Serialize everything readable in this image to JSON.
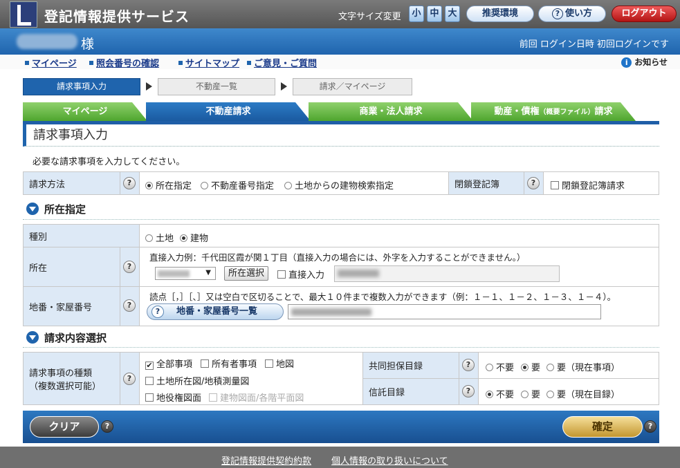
{
  "header": {
    "app_title": "登記情報提供サービス",
    "font_size_label": "文字サイズ変更",
    "font_sizes": [
      "小",
      "中",
      "大"
    ],
    "recommended_env": "推奨環境",
    "how_to_use": "使い方",
    "logout": "ログアウト"
  },
  "user_bar": {
    "honorific": "様",
    "last_login": "前回 ログイン日時 初回ログインです"
  },
  "nav": {
    "links": [
      "マイページ",
      "照会番号の確認",
      "サイトマップ",
      "ご意見・ご質問"
    ],
    "notice": "お知らせ"
  },
  "steps": [
    "請求事項入力",
    "不動産一覧",
    "請求／マイページ"
  ],
  "tabs": {
    "mypage": "マイページ",
    "real_estate": "不動産請求",
    "commercial": "商業・法人請求",
    "movable_main": "動産・債権",
    "movable_small": "（概要ファイル）",
    "movable_suffix": "請求"
  },
  "page": {
    "title": "請求事項入力",
    "intro": "必要な請求事項を入力してください。"
  },
  "request_method": {
    "label": "請求方法",
    "options": [
      "所在指定",
      "不動産番号指定",
      "土地からの建物検索指定"
    ],
    "closed_label": "閉鎖登記簿",
    "closed_option": "閉鎖登記簿請求"
  },
  "location_section": {
    "heading": "所在指定",
    "type_label": "種別",
    "type_options": [
      "土地",
      "建物"
    ],
    "location_label": "所在",
    "location_hint": "直接入力例：千代田区霞が関１丁目（直接入力の場合には、外字を入力することができません。）",
    "location_select_button": "所在選択",
    "direct_input": "直接入力",
    "lot_label": "地番・家屋番号",
    "lot_hint": "読点［，］［、］又は空白で区切ることで、最大１０件まで複数入力ができます（例：１－１、１－２、１－３、１－４）。",
    "lot_list_button": "地番・家屋番号一覧"
  },
  "content_section": {
    "heading": "請求内容選択",
    "kind_label_1": "請求事項の種類",
    "kind_label_2": "（複数選択可能）",
    "kind_options": [
      "全部事項",
      "所有者事項",
      "地図",
      "土地所在図/地積測量図",
      "地役権図面",
      "建物図面/各階平面図"
    ],
    "joint_label": "共同担保目録",
    "joint_options": [
      "不要",
      "要",
      "要（現在事項）"
    ],
    "trust_label": "信託目録",
    "trust_options": [
      "不要",
      "要",
      "要（現在目録）"
    ]
  },
  "actions": {
    "clear": "クリア",
    "confirm": "確定"
  },
  "footer": {
    "terms": "登記情報提供契約約款",
    "privacy": "個人情報の取り扱いについて"
  }
}
